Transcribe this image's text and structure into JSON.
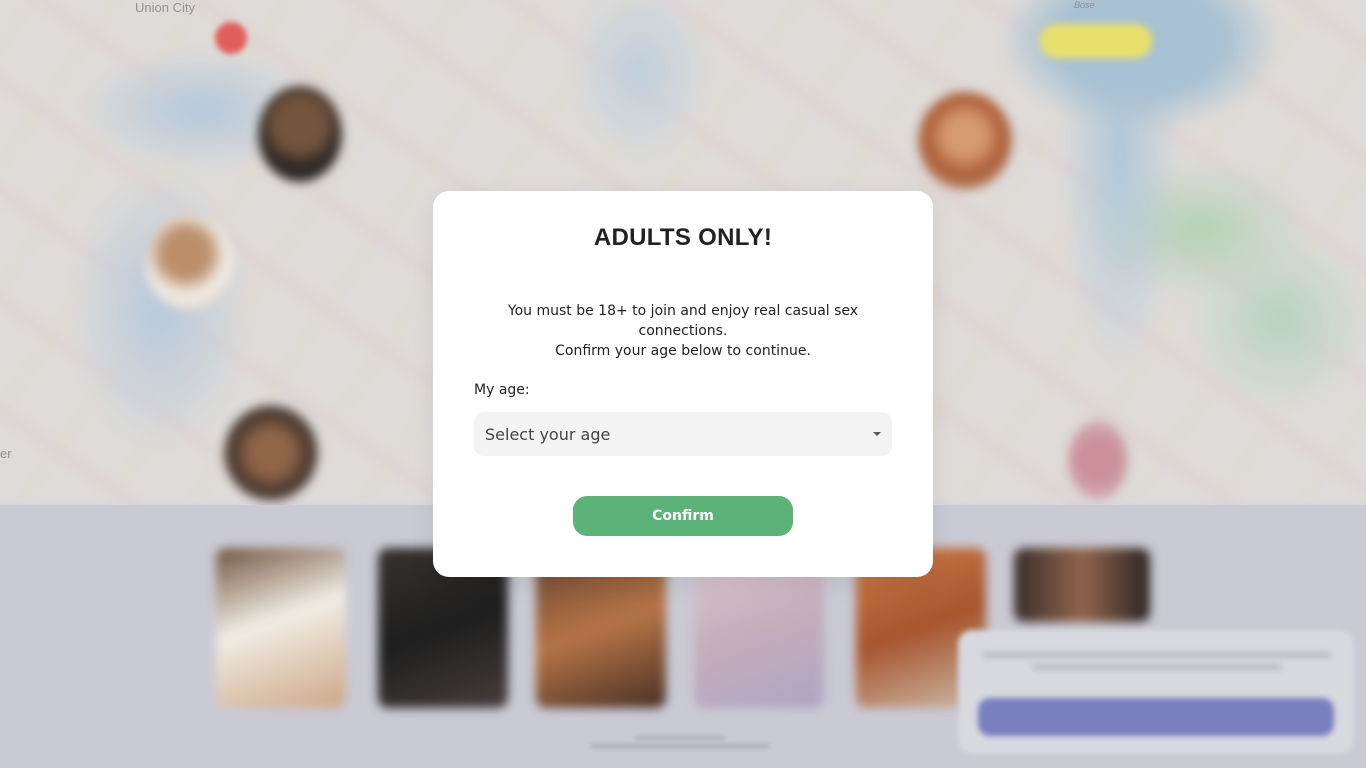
{
  "background": {
    "map_labels": [
      "Union City",
      "Bose",
      "er"
    ],
    "accent_colors": {
      "pin": "#e0554f",
      "cookie_button": "#7278bd"
    }
  },
  "modal": {
    "title": "ADULTS ONLY!",
    "description_line1": "You must be 18+ to join and enjoy real casual sex connections.",
    "description_line2": "Confirm your age below to continue.",
    "age_label": "My age:",
    "age_select": {
      "selected": "Select your age",
      "icon": "caret-down-icon"
    },
    "confirm_label": "Confirm",
    "confirm_color": "#5bb37a"
  }
}
